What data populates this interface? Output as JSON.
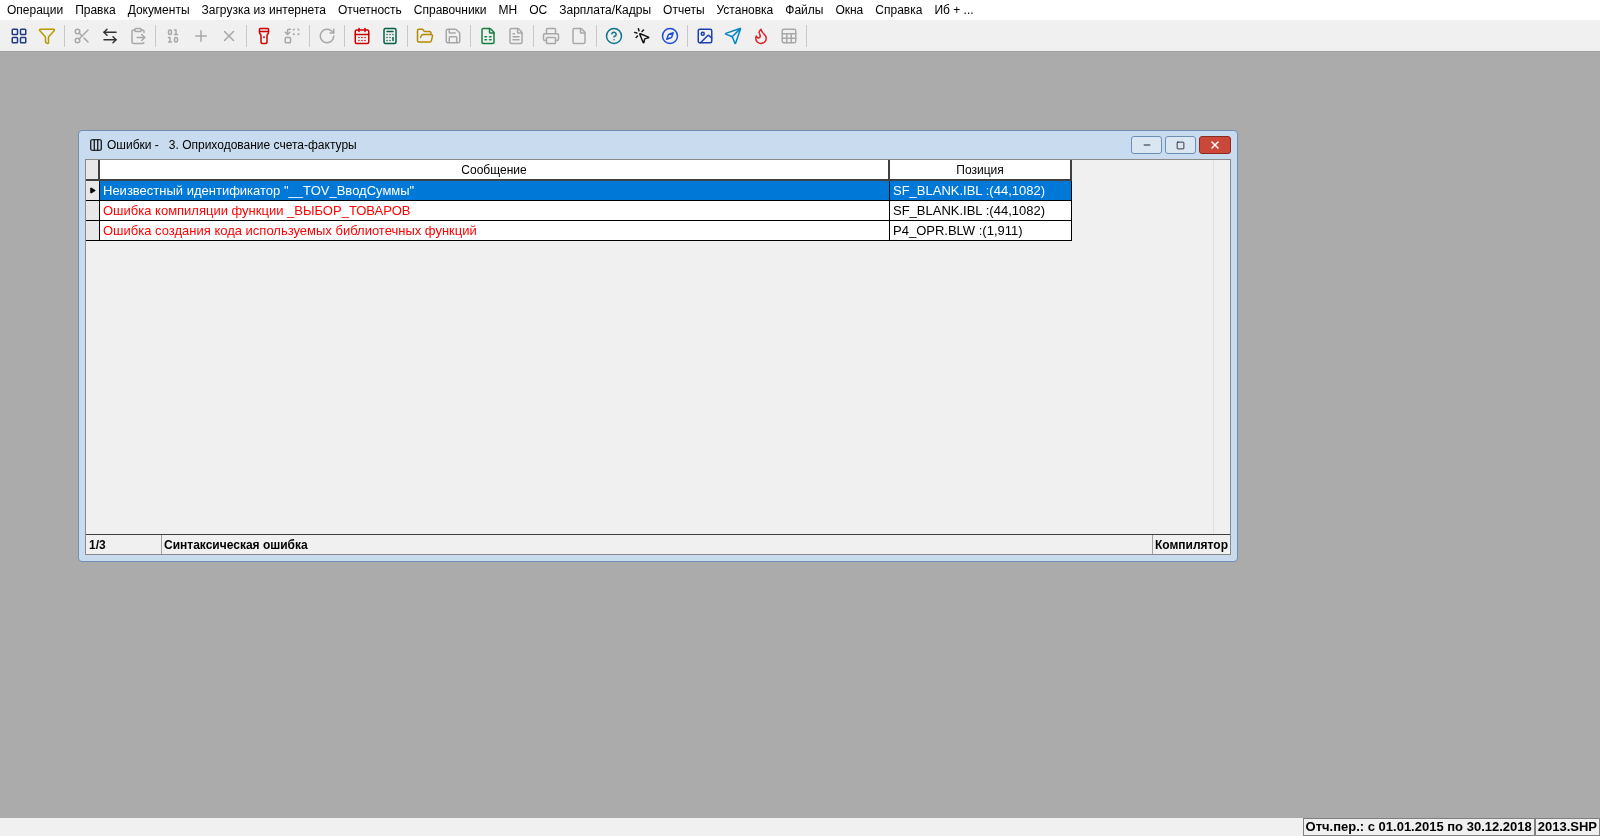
{
  "menu": [
    "Операции",
    "Правка",
    "Документы",
    "Загрузка из интернета",
    "Отчетность",
    "Справочники",
    "МН",
    "ОС",
    "Зарплата/Кадры",
    "Отчеты",
    "Установка",
    "Файлы",
    "Окна",
    "Справка",
    "Иб + ..."
  ],
  "toolbar": [
    [
      {
        "kind": "grid",
        "disabled": false
      },
      {
        "kind": "filter",
        "disabled": false
      }
    ],
    [
      {
        "kind": "scissors",
        "disabled": true
      },
      {
        "kind": "transfer",
        "disabled": false
      },
      {
        "kind": "paste",
        "disabled": true
      }
    ],
    [
      {
        "kind": "binary",
        "disabled": true
      },
      {
        "kind": "plus",
        "disabled": true
      },
      {
        "kind": "delete",
        "disabled": true
      }
    ],
    [
      {
        "kind": "flashlight",
        "disabled": false
      },
      {
        "kind": "replace",
        "disabled": true
      }
    ],
    [
      {
        "kind": "refresh",
        "disabled": true
      }
    ],
    [
      {
        "kind": "calendar",
        "disabled": false
      },
      {
        "kind": "calculator",
        "disabled": false
      }
    ],
    [
      {
        "kind": "open",
        "disabled": false
      },
      {
        "kind": "save",
        "disabled": true
      }
    ],
    [
      {
        "kind": "excel",
        "disabled": false
      },
      {
        "kind": "word",
        "disabled": true
      }
    ],
    [
      {
        "kind": "print",
        "disabled": true
      },
      {
        "kind": "page",
        "disabled": true
      }
    ],
    [
      {
        "kind": "help",
        "disabled": false
      },
      {
        "kind": "context-help",
        "disabled": false
      },
      {
        "kind": "compass",
        "disabled": false
      }
    ],
    [
      {
        "kind": "picture",
        "disabled": false
      },
      {
        "kind": "bird",
        "disabled": false
      },
      {
        "kind": "logo",
        "disabled": false
      },
      {
        "kind": "sheet",
        "disabled": true
      }
    ]
  ],
  "window": {
    "title": "Ошибки -   3. Оприходование счета-фактуры",
    "table": {
      "columns": [
        "Сообщение",
        "Позиция"
      ],
      "rows": [
        {
          "message": "Неизвестный идентификатор \"__TOV_ВводСуммы\"",
          "position": "SF_BLANK.IBL :(44,1082)",
          "selected": true
        },
        {
          "message": "Ошибка компиляции функции _ВЫБОР_ТОВАРОВ",
          "position": "SF_BLANK.IBL :(44,1082)",
          "selected": false
        },
        {
          "message": "Ошибка создания кода используемых библиотечных функций",
          "position": "P4_OPR.BLW :(1,911)",
          "selected": false
        }
      ]
    },
    "status": [
      "1/3",
      "Синтаксическая ошибка",
      "Компилятор"
    ]
  },
  "status_bar": [
    "Отч.пер.: с 01.01.2015 по 30.12.2018",
    "2013.SHP"
  ]
}
